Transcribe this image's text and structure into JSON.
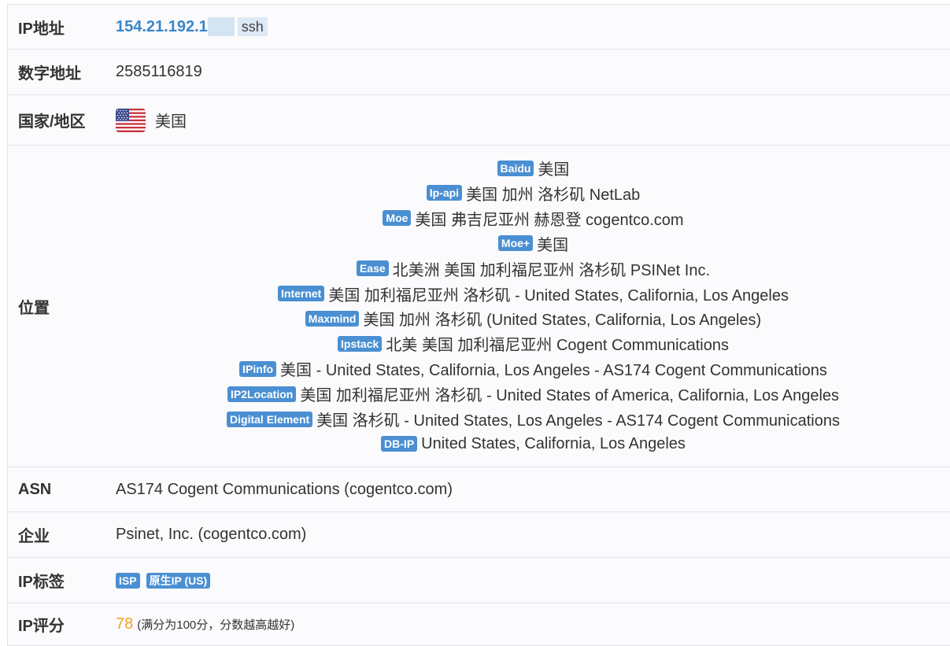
{
  "rows": {
    "ip": {
      "label": "IP地址",
      "value": "154.21.192.1",
      "ssh": "ssh"
    },
    "numeric": {
      "label": "数字地址",
      "value": "2585116819"
    },
    "country": {
      "label": "国家/地区",
      "flag_icon": "us-flag-icon",
      "value": "美国"
    },
    "location": {
      "label": "位置",
      "entries": [
        {
          "source": "Baidu",
          "text": "美国"
        },
        {
          "source": "Ip-api",
          "text": "美国 加州 洛杉矶 NetLab"
        },
        {
          "source": "Moe",
          "text": "美国 弗吉尼亚州 赫恩登 cogentco.com"
        },
        {
          "source": "Moe+",
          "text": "美国"
        },
        {
          "source": "Ease",
          "text": "北美洲 美国 加利福尼亚州 洛杉矶 PSINet Inc."
        },
        {
          "source": "Internet",
          "text": "美国 加利福尼亚州 洛杉矶 - United States, California, Los Angeles"
        },
        {
          "source": "Maxmind",
          "text": "美国 加州 洛杉矶 (United States, California, Los Angeles)"
        },
        {
          "source": "Ipstack",
          "text": "北美 美国 加利福尼亚州 Cogent Communications"
        },
        {
          "source": "IPinfo",
          "text": "美国 - United States, California, Los Angeles - AS174 Cogent Communications"
        },
        {
          "source": "IP2Location",
          "text": "美国 加利福尼亚州 洛杉矶 - United States of America, California, Los Angeles"
        },
        {
          "source": "Digital Element",
          "text": "美国 洛杉矶 - United States, Los Angeles - AS174 Cogent Communications"
        },
        {
          "source": "DB-IP",
          "text": "United States, California, Los Angeles"
        }
      ]
    },
    "asn": {
      "label": "ASN",
      "value": "AS174 Cogent Communications (cogentco.com)"
    },
    "org": {
      "label": "企业",
      "value": "Psinet, Inc. (cogentco.com)"
    },
    "tags": {
      "label": "IP标签",
      "items": [
        "ISP",
        "原生IP (US)"
      ]
    },
    "score": {
      "label": "IP评分",
      "value": "78",
      "note": "(满分为100分，分数越高越好)"
    }
  },
  "colors": {
    "link": "#3a86c8",
    "badge": "#4a8fd2",
    "score": "#f0a020",
    "border": "#e2e5ea"
  }
}
